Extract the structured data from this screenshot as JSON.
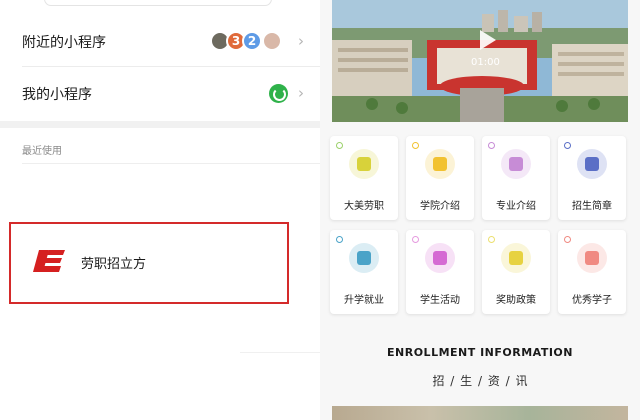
{
  "left": {
    "nearby": {
      "label": "附近的小程序",
      "avatar_digits": [
        "3",
        "2"
      ]
    },
    "mine": {
      "label": "我的小程序"
    },
    "recent_label": "最近使用",
    "app": {
      "name": "劳职招立方"
    },
    "chevron": "›"
  },
  "right": {
    "video": {
      "time": "01:00"
    },
    "cards": [
      {
        "label": "大美劳职",
        "icon": "building-icon",
        "color": "#d8d23a",
        "dot": "#9bd16a"
      },
      {
        "label": "学院介绍",
        "icon": "document-icon",
        "color": "#f2c230",
        "dot": "#f2c230"
      },
      {
        "label": "专业介绍",
        "icon": "graduation-cap-icon",
        "color": "#c78cd6",
        "dot": "#c78cd6"
      },
      {
        "label": "招生简章",
        "icon": "info-icon",
        "color": "#5b6fc6",
        "dot": "#5b6fc6"
      },
      {
        "label": "升学就业",
        "icon": "briefcase-icon",
        "color": "#4aa3c8",
        "dot": "#4aa3c8"
      },
      {
        "label": "学生活动",
        "icon": "people-icon",
        "color": "#d56ad3",
        "dot": "#e59adf"
      },
      {
        "label": "奖助政策",
        "icon": "award-icon",
        "color": "#e7d241",
        "dot": "#ece070"
      },
      {
        "label": "优秀学子",
        "icon": "student-icon",
        "color": "#f08a82",
        "dot": "#f08a82"
      }
    ],
    "enroll_title": "ENROLLMENT INFORMATION",
    "enroll_sub": "招 / 生 / 资 / 讯"
  }
}
